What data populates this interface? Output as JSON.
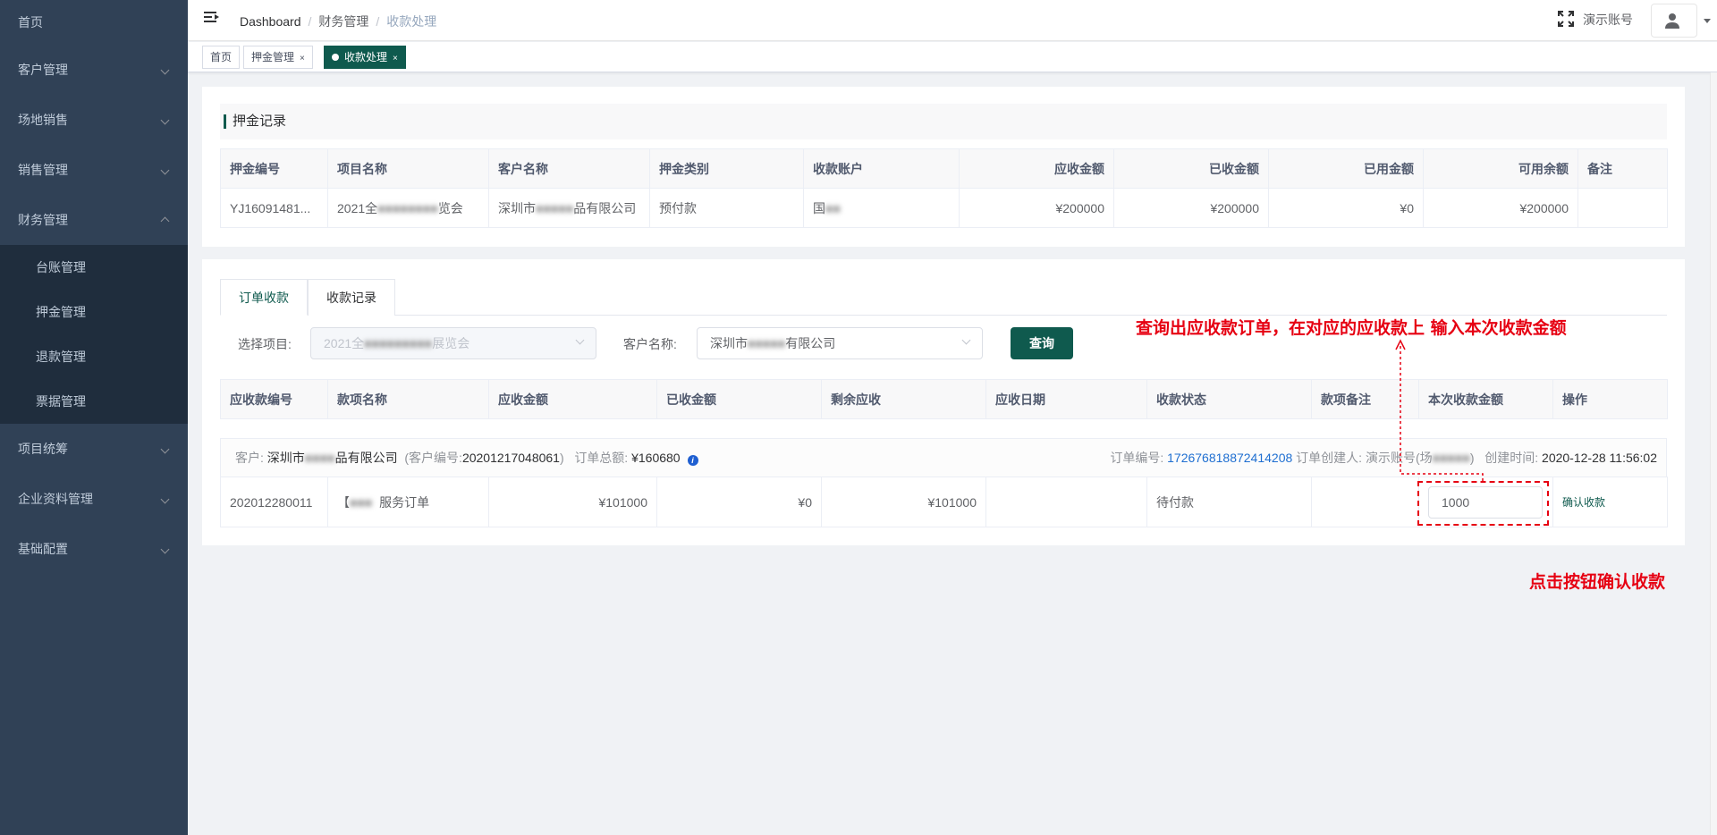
{
  "sidebar": {
    "items": [
      {
        "label": "首页",
        "chevron": "none"
      },
      {
        "label": "客户管理",
        "chevron": "down"
      },
      {
        "label": "场地销售",
        "chevron": "down"
      },
      {
        "label": "销售管理",
        "chevron": "down"
      },
      {
        "label": "财务管理",
        "chevron": "up"
      },
      {
        "label": "项目统筹",
        "chevron": "down"
      },
      {
        "label": "企业资料管理",
        "chevron": "down"
      },
      {
        "label": "基础配置",
        "chevron": "down"
      }
    ],
    "finance_submenu": [
      "台账管理",
      "押金管理",
      "退款管理",
      "票据管理"
    ]
  },
  "header": {
    "breadcrumb": [
      "Dashboard",
      "财务管理",
      "收款处理"
    ],
    "account": "演示账号",
    "icons": {
      "menu": "hamburger-icon",
      "fullscreen": "fullscreen-icon",
      "user": "user-icon"
    }
  },
  "tags": [
    {
      "label": "首页",
      "closable": false
    },
    {
      "label": "押金管理",
      "closable": true,
      "close": "×"
    },
    {
      "label": "收款处理",
      "closable": true,
      "close": "×",
      "active": true
    }
  ],
  "deposit": {
    "title": "押金记录",
    "columns": [
      "押金编号",
      "项目名称",
      "客户名称",
      "押金类别",
      "收款账户",
      "应收金额",
      "已收金额",
      "已用金额",
      "可用余额",
      "备注"
    ],
    "row": {
      "id": "YJ16091481...",
      "project_a": "2021全",
      "project_b": "览会",
      "customer_a": "深圳市",
      "customer_b": "品有限公司",
      "category": "预付款",
      "account": "国",
      "receivable": "¥200000",
      "received": "¥200000",
      "used": "¥0",
      "balance": "¥200000",
      "remark": ""
    }
  },
  "tabs": [
    "订单收款",
    "收款记录"
  ],
  "filter": {
    "project_label": "选择项目:",
    "project_value_a": "2021全",
    "project_value_b": "展览会",
    "customer_label": "客户名称:",
    "customer_value_a": "深圳市",
    "customer_value_b": "有限公司",
    "query_button": "查询"
  },
  "receivables": {
    "columns": [
      "应收款编号",
      "款项名称",
      "应收金额",
      "已收金额",
      "剩余应收",
      "应收日期",
      "收款状态",
      "款项备注",
      "本次收款金额",
      "操作"
    ],
    "order": {
      "customer_label": "客户:",
      "customer_a": "深圳市",
      "customer_b": "品有限公司",
      "customer_no_label": "(客户编号:",
      "customer_no": "20201217048061",
      "customer_no_close": ")",
      "total_label": "订单总额:",
      "total": "¥160680",
      "order_no_label": "订单编号:",
      "order_no": "172676818872414208",
      "creator_label": "订单创建人:",
      "creator_a": "演示账号(场",
      "creator_b": ")",
      "created_label": "创建时间:",
      "created": "2020-12-28 11:56:02"
    },
    "row": {
      "id": "202012280011",
      "name_prefix": "【",
      "name_suffix": "服务订单",
      "receivable": "¥101000",
      "received": "¥0",
      "remaining": "¥101000",
      "due_date": "",
      "status": "待付款",
      "remark": "",
      "amount": "1000",
      "action": "确认收款"
    }
  },
  "annotations": {
    "top": "查询出应收款订单，在对应的应收款上  输入本次收款金额",
    "bottom": "点击按钮确认收款",
    "color": "#e60012"
  }
}
